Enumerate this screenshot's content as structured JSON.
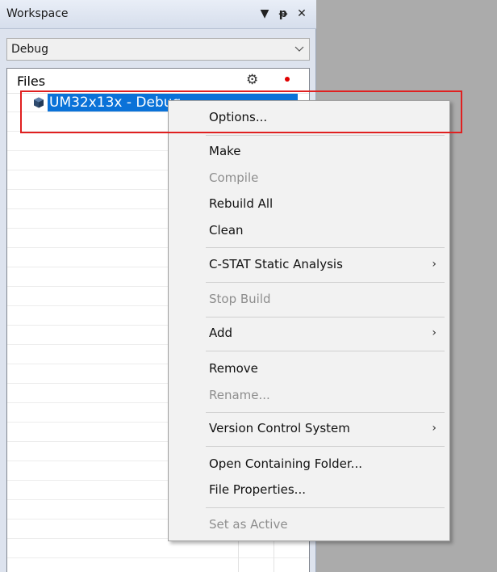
{
  "panel": {
    "title": "Workspace",
    "controls": {
      "dropdown_glyph": "▼",
      "pin_glyph": "ᵽ",
      "close_glyph": "✕"
    },
    "configuration": {
      "selected": "Debug"
    }
  },
  "tree": {
    "header": {
      "files_label": "Files",
      "gear_glyph": "⚙"
    },
    "project": {
      "label": "UM32x13x - Debug",
      "icon": "cube-icon"
    }
  },
  "context_menu": {
    "items": [
      {
        "label": "Options...",
        "enabled": true
      },
      {
        "label": "Make",
        "enabled": true
      },
      {
        "label": "Compile",
        "enabled": false
      },
      {
        "label": "Rebuild All",
        "enabled": true
      },
      {
        "label": "Clean",
        "enabled": true
      },
      {
        "label": "C-STAT Static Analysis",
        "enabled": true,
        "submenu": true
      },
      {
        "label": "Stop Build",
        "enabled": false
      },
      {
        "label": "Add",
        "enabled": true,
        "submenu": true
      },
      {
        "label": "Remove",
        "enabled": true
      },
      {
        "label": "Rename...",
        "enabled": false
      },
      {
        "label": "Version Control System",
        "enabled": true,
        "submenu": true
      },
      {
        "label": "Open Containing Folder...",
        "enabled": true
      },
      {
        "label": "File Properties...",
        "enabled": true
      },
      {
        "label": "Set as Active",
        "enabled": false
      }
    ],
    "submenu_glyph": "›"
  },
  "colors": {
    "selection": "#0a72d8",
    "highlight_box": "#e02020",
    "status_dot": "#e00000"
  }
}
